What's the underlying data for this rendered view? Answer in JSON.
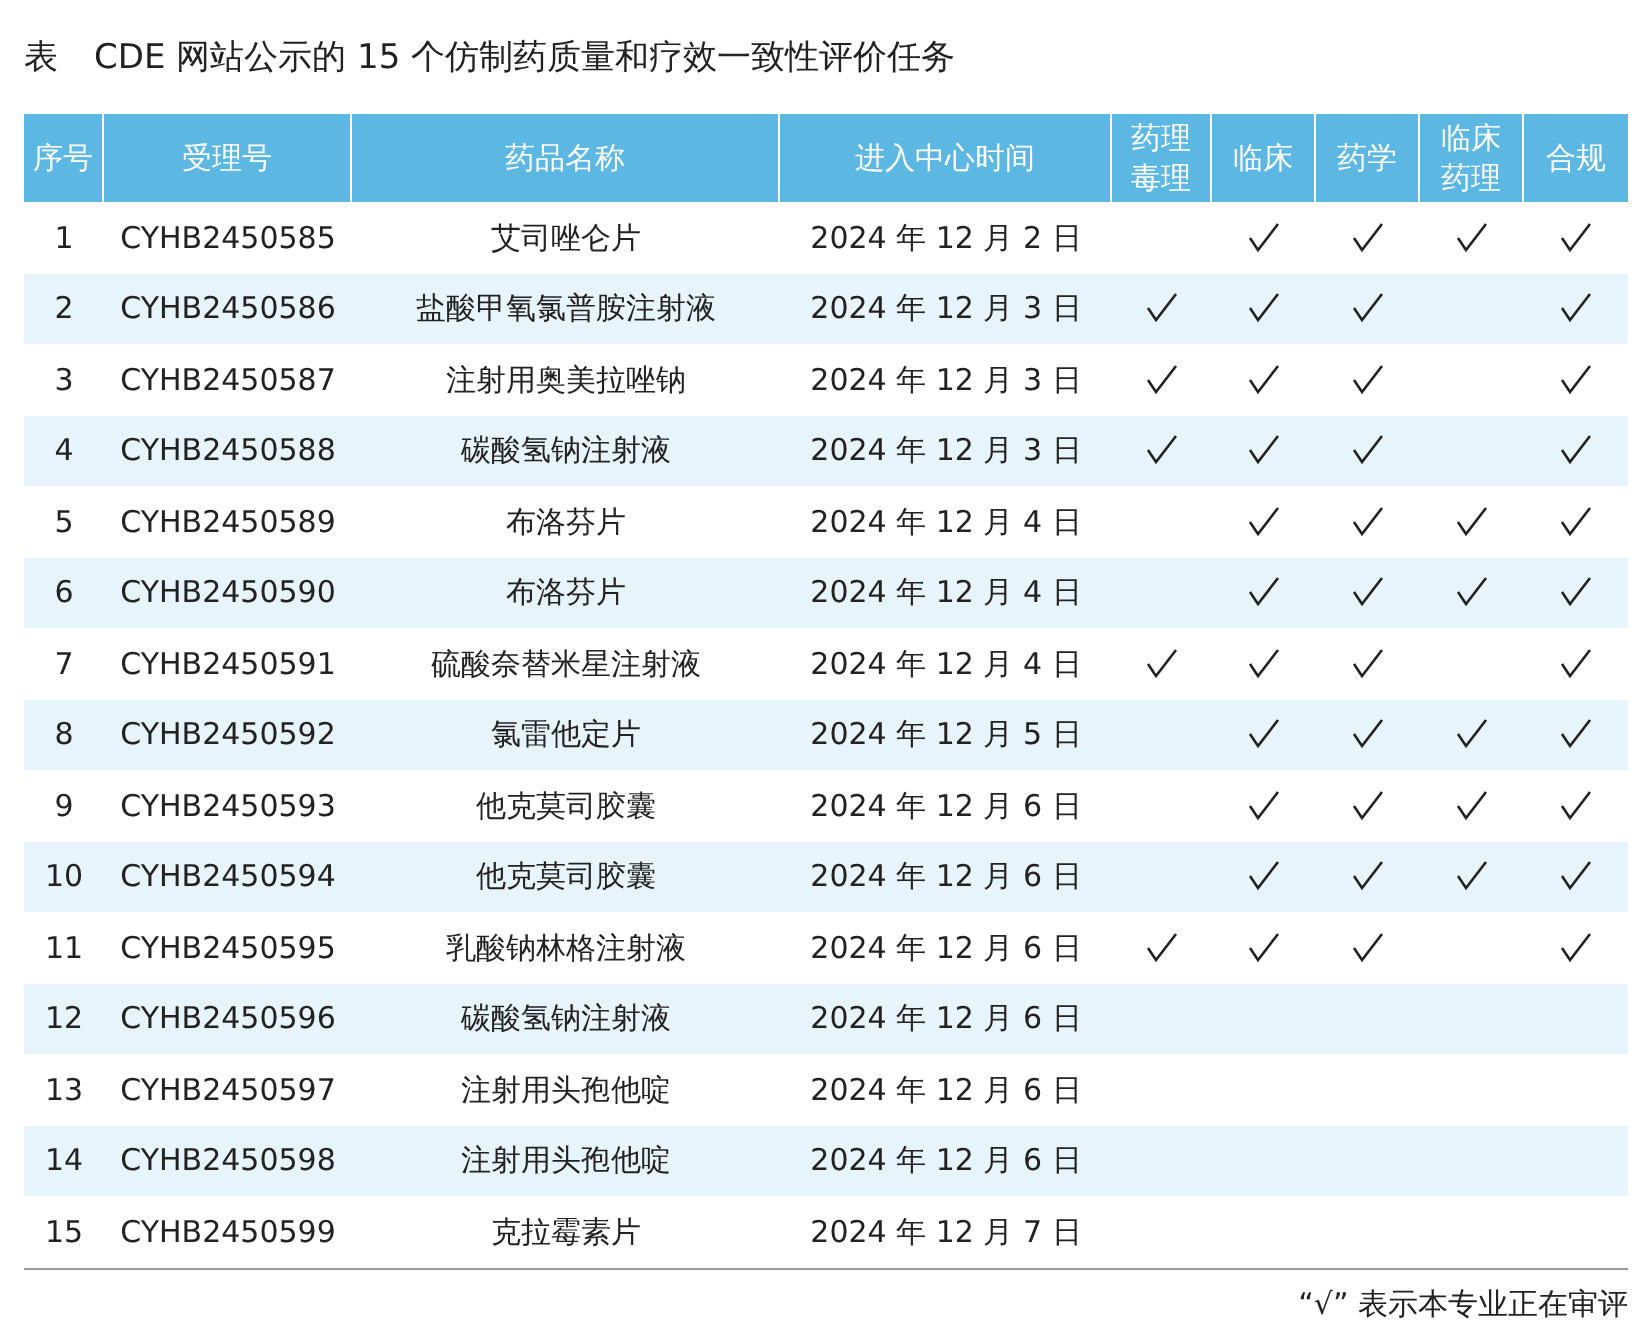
{
  "title": {
    "label": "表",
    "text": "CDE 网站公示的 15 个仿制药质量和疗效一致性评价任务"
  },
  "table": {
    "columns": [
      "序号",
      "受理号",
      "药品名称",
      "进入中心时间",
      "药理毒理",
      "临床",
      "药学",
      "临床药理",
      "合规"
    ],
    "rows": [
      {
        "no": "1",
        "id": "CYHB2450585",
        "name": "艾司唑仑片",
        "date": "2024 年 12 月 2 日",
        "checks": [
          false,
          true,
          true,
          true,
          true
        ]
      },
      {
        "no": "2",
        "id": "CYHB2450586",
        "name": "盐酸甲氧氯普胺注射液",
        "date": "2024 年 12 月 3 日",
        "checks": [
          true,
          true,
          true,
          false,
          true
        ]
      },
      {
        "no": "3",
        "id": "CYHB2450587",
        "name": "注射用奥美拉唑钠",
        "date": "2024 年 12 月 3 日",
        "checks": [
          true,
          true,
          true,
          false,
          true
        ]
      },
      {
        "no": "4",
        "id": "CYHB2450588",
        "name": "碳酸氢钠注射液",
        "date": "2024 年 12 月 3 日",
        "checks": [
          true,
          true,
          true,
          false,
          true
        ]
      },
      {
        "no": "5",
        "id": "CYHB2450589",
        "name": "布洛芬片",
        "date": "2024 年 12 月 4 日",
        "checks": [
          false,
          true,
          true,
          true,
          true
        ]
      },
      {
        "no": "6",
        "id": "CYHB2450590",
        "name": "布洛芬片",
        "date": "2024 年 12 月 4 日",
        "checks": [
          false,
          true,
          true,
          true,
          true
        ]
      },
      {
        "no": "7",
        "id": "CYHB2450591",
        "name": "硫酸奈替米星注射液",
        "date": "2024 年 12 月 4 日",
        "checks": [
          true,
          true,
          true,
          false,
          true
        ]
      },
      {
        "no": "8",
        "id": "CYHB2450592",
        "name": "氯雷他定片",
        "date": "2024 年 12 月 5 日",
        "checks": [
          false,
          true,
          true,
          true,
          true
        ]
      },
      {
        "no": "9",
        "id": "CYHB2450593",
        "name": "他克莫司胶囊",
        "date": "2024 年 12 月 6 日",
        "checks": [
          false,
          true,
          true,
          true,
          true
        ]
      },
      {
        "no": "10",
        "id": "CYHB2450594",
        "name": "他克莫司胶囊",
        "date": "2024 年 12 月 6 日",
        "checks": [
          false,
          true,
          true,
          true,
          true
        ]
      },
      {
        "no": "11",
        "id": "CYHB2450595",
        "name": "乳酸钠林格注射液",
        "date": "2024 年 12 月 6 日",
        "checks": [
          true,
          true,
          true,
          false,
          true
        ]
      },
      {
        "no": "12",
        "id": "CYHB2450596",
        "name": "碳酸氢钠注射液",
        "date": "2024 年 12 月 6 日",
        "checks": [
          false,
          false,
          false,
          false,
          false
        ]
      },
      {
        "no": "13",
        "id": "CYHB2450597",
        "name": "注射用头孢他啶",
        "date": "2024 年 12 月 6 日",
        "checks": [
          false,
          false,
          false,
          false,
          false
        ]
      },
      {
        "no": "14",
        "id": "CYHB2450598",
        "name": "注射用头孢他啶",
        "date": "2024 年 12 月 6 日",
        "checks": [
          false,
          false,
          false,
          false,
          false
        ]
      },
      {
        "no": "15",
        "id": "CYHB2450599",
        "name": "克拉霉素片",
        "date": "2024 年 12 月 7 日",
        "checks": [
          false,
          false,
          false,
          false,
          false
        ]
      }
    ]
  },
  "footnote": "“√” 表示本专业正在审评"
}
